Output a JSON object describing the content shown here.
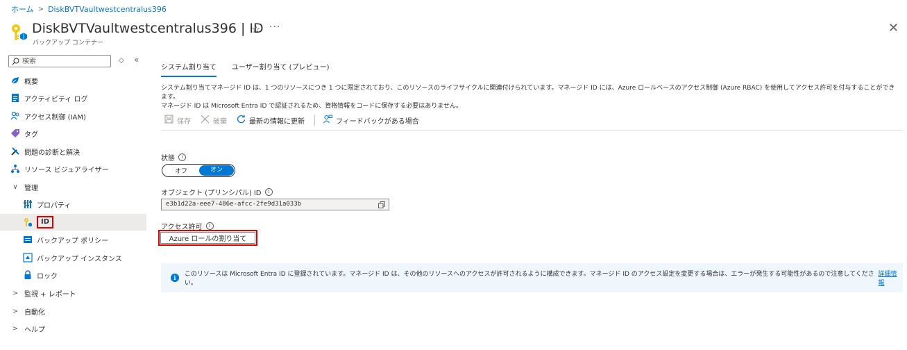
{
  "breadcrumb": {
    "home": "ホーム",
    "current": "DiskBVTVaultwestcentralus396"
  },
  "header": {
    "title": "DiskBVTVaultwestcentralus396 | ID",
    "subtitle": "バックアップ コンテナー",
    "star": "☆",
    "more": "···",
    "close": "✕"
  },
  "sidebar": {
    "search_placeholder": "検索",
    "items": {
      "overview": "概要",
      "activity_log": "アクティビティ ログ",
      "iam": "アクセス制御 (IAM)",
      "tags": "タグ",
      "diagnose": "問題の診断と解決",
      "visualizer": "リソース ビジュアライザー",
      "manage": "管理",
      "properties": "プロパティ",
      "identity": "ID",
      "backup_policy": "バックアップ ポリシー",
      "backup_instance": "バックアップ インスタンス",
      "lock": "ロック",
      "monitoring": "監視 + レポート",
      "automation": "自動化",
      "help": "ヘルプ"
    }
  },
  "main": {
    "tabs": {
      "system": "システム割り当て",
      "user": "ユーザー割り当て (プレビュー)"
    },
    "description_line1": "システム割り当てマネージド ID は、1 つのリソースにつき 1 つに限定されており、このリソースのライフサイクルに関連付けられています。マネージド ID には、Azure ロールベースのアクセス制御 (Azure RBAC) を使用してアクセス許可を付与することができます。",
    "description_line2": "マネージド ID は Microsoft Entra ID で認証されるため、資格情報をコードに保存する必要はありません。",
    "toolbar": {
      "save": "保存",
      "discard": "破棄",
      "refresh": "最新の情報に更新",
      "feedback": "フィードバックがある場合"
    },
    "status_label": "状態",
    "toggle": {
      "off": "オフ",
      "on": "オン"
    },
    "object_id_label": "オブジェクト (プリンシパル) ID",
    "object_id_value": "e3b1d22a-eee7-486e-afcc-2fe9d31a033b",
    "permissions_label": "アクセス許可",
    "azure_role_button": "Azure ロールの割り当て",
    "banner_text": "このリソースは Microsoft Entra ID に登録されています。マネージド ID は、その他のリソースへのアクセスが許可されるように構成できます。マネージド ID のアクセス設定を変更する場合は、エラーが発生する可能性があるので注意してください。",
    "banner_link": "詳細情報"
  },
  "colors": {
    "accent": "#0078d4",
    "highlight_red": "#e00000",
    "selected_bg": "#edebe9",
    "banner_bg": "#eff6fc"
  }
}
